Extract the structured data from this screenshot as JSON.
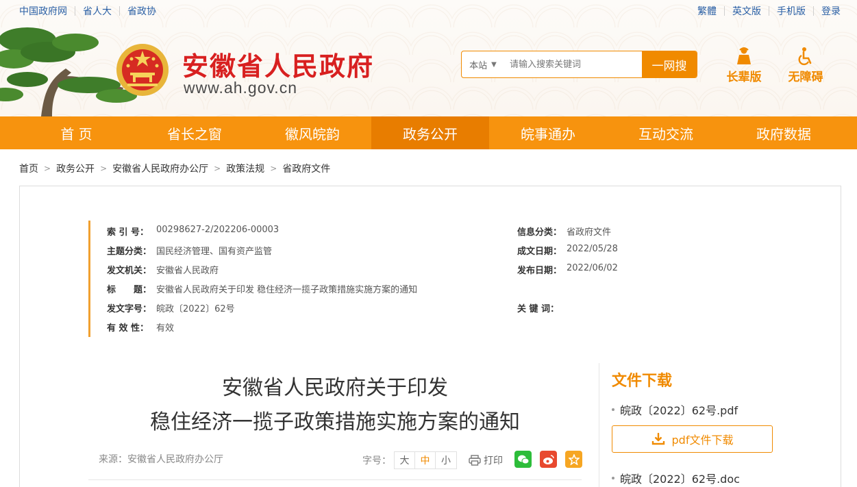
{
  "topbar": {
    "left_links": [
      "中国政府网",
      "省人大",
      "省政协"
    ],
    "right_links": [
      "繁體",
      "英文版",
      "手机版",
      "登录"
    ]
  },
  "header": {
    "site_title": "安徽省人民政府",
    "site_url": "www.ah.gov.cn",
    "search": {
      "scope": "本站",
      "placeholder": "请输入搜索关键词",
      "button": "一网搜"
    },
    "modes": [
      {
        "label": "长辈版",
        "icon": "elder-icon"
      },
      {
        "label": "无障碍",
        "icon": "wheelchair-icon"
      }
    ],
    "accent_color": "#f08a00",
    "title_color": "#d82020"
  },
  "nav": {
    "items": [
      "首 页",
      "省长之窗",
      "徽风皖韵",
      "政务公开",
      "皖事通办",
      "互动交流",
      "政府数据"
    ],
    "active": "政务公开"
  },
  "breadcrumb": [
    "首页",
    "政务公开",
    "安徽省人民政府办公厅",
    "政策法规",
    "省政府文件"
  ],
  "meta": {
    "index_no_label": "索 引 号：",
    "index_no": "00298627-2/202206-00003",
    "topic_label": "主题分类：",
    "topic": "国民经济管理、国有资产监管",
    "issuer_label": "发文机关：",
    "issuer": "安徽省人民政府",
    "title_label": "标　　题：",
    "title": "安徽省人民政府关于印发 稳住经济一揽子政策措施实施方案的通知",
    "doc_no_label": "发文字号：",
    "doc_no": "皖政〔2022〕62号",
    "validity_label": "有 效 性：",
    "validity": "有效",
    "category_label": "信息分类：",
    "category": "省政府文件",
    "created_label": "成文日期：",
    "created": "2022/05/28",
    "published_label": "发布日期：",
    "published": "2022/06/02",
    "keywords_label": "关 键 词：",
    "keywords": ""
  },
  "article": {
    "title_line1": "安徽省人民政府关于印发",
    "title_line2": "稳住经济一揽子政策措施实施方案的通知",
    "source": "来源：安徽省人民政府办公厅",
    "font_size_label": "字号：",
    "font_sizes": [
      "大",
      "中",
      "小"
    ],
    "font_size_selected": "中",
    "print_label": "打印"
  },
  "downloads": {
    "title": "文件下载",
    "files": [
      "皖政〔2022〕62号.pdf",
      "皖政〔2022〕62号.doc"
    ],
    "pdf_button": "pdf文件下载"
  }
}
